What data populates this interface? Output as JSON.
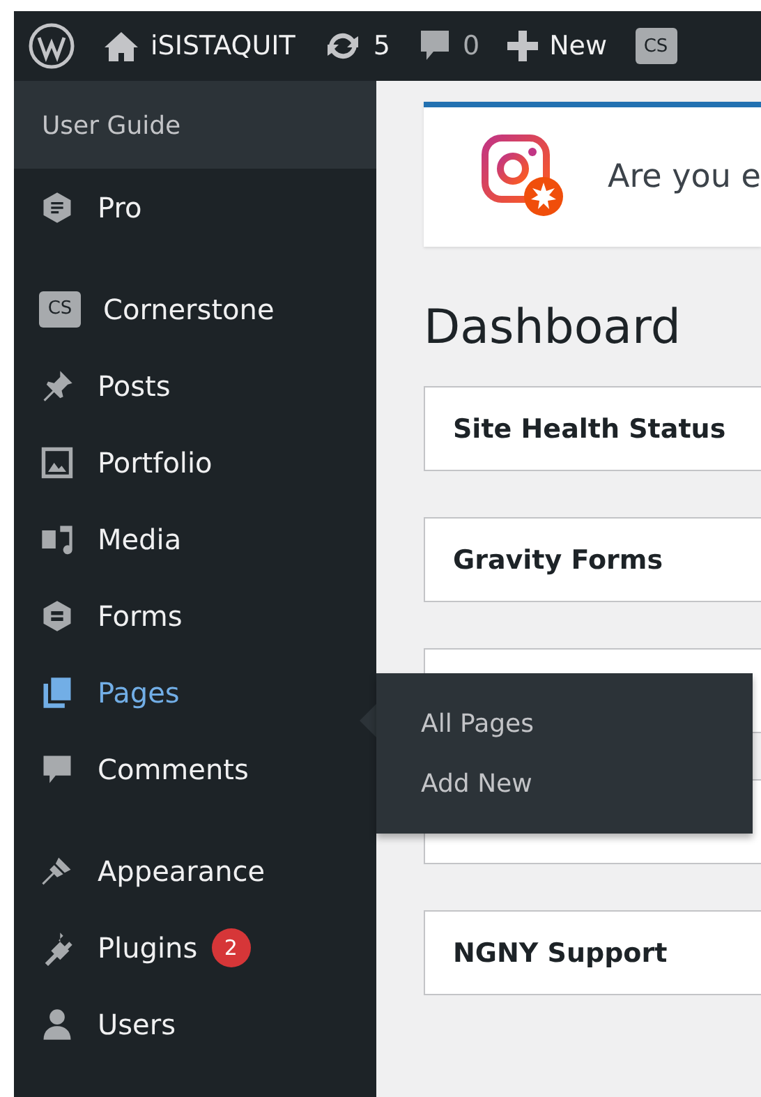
{
  "admin_bar": {
    "site_name": "iSISTAQUIT",
    "updates_count": "5",
    "comments_count": "0",
    "new_label": "New",
    "cs_label": "CS"
  },
  "sidebar": {
    "submenu_items": [
      {
        "label": "User Guide"
      }
    ],
    "groups": [
      [
        {
          "label": "Pro",
          "selected": false
        }
      ],
      [
        {
          "label": "Cornerstone",
          "selected": false,
          "icon_text": "CS"
        },
        {
          "label": "Posts",
          "selected": false
        },
        {
          "label": "Portfolio",
          "selected": false
        },
        {
          "label": "Media",
          "selected": false
        },
        {
          "label": "Forms",
          "selected": false
        },
        {
          "label": "Pages",
          "selected": true
        },
        {
          "label": "Comments",
          "selected": false
        }
      ],
      [
        {
          "label": "Appearance",
          "selected": false
        },
        {
          "label": "Plugins",
          "selected": false,
          "badge": "2"
        },
        {
          "label": "Users",
          "selected": false
        }
      ]
    ]
  },
  "flyout": {
    "items": [
      {
        "label": "All Pages"
      },
      {
        "label": "Add New"
      }
    ]
  },
  "notice": {
    "text": "Are you e"
  },
  "page_title": "Dashboard",
  "widgets": [
    {
      "title": "Site Health Status"
    },
    {
      "title": "Gravity Forms"
    }
  ],
  "widgets_below_flyout": [
    {
      "title": "NGNY Support"
    }
  ]
}
